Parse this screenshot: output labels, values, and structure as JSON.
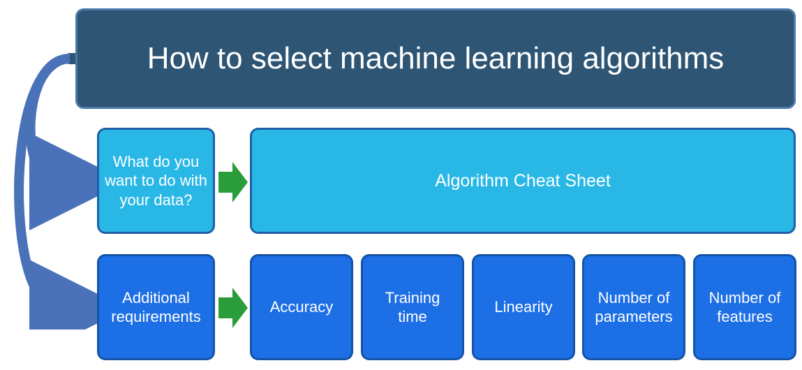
{
  "title": "How to select machine learning algorithms",
  "questionBox": "What do you want to do with your data?",
  "cheatSheet": "Algorithm Cheat Sheet",
  "additional": "Additional requirements",
  "factors": {
    "accuracy": "Accuracy",
    "trainingTime": "Training time",
    "linearity": "Linearity",
    "numParams": "Number of parameters",
    "numFeatures": "Number of features"
  }
}
